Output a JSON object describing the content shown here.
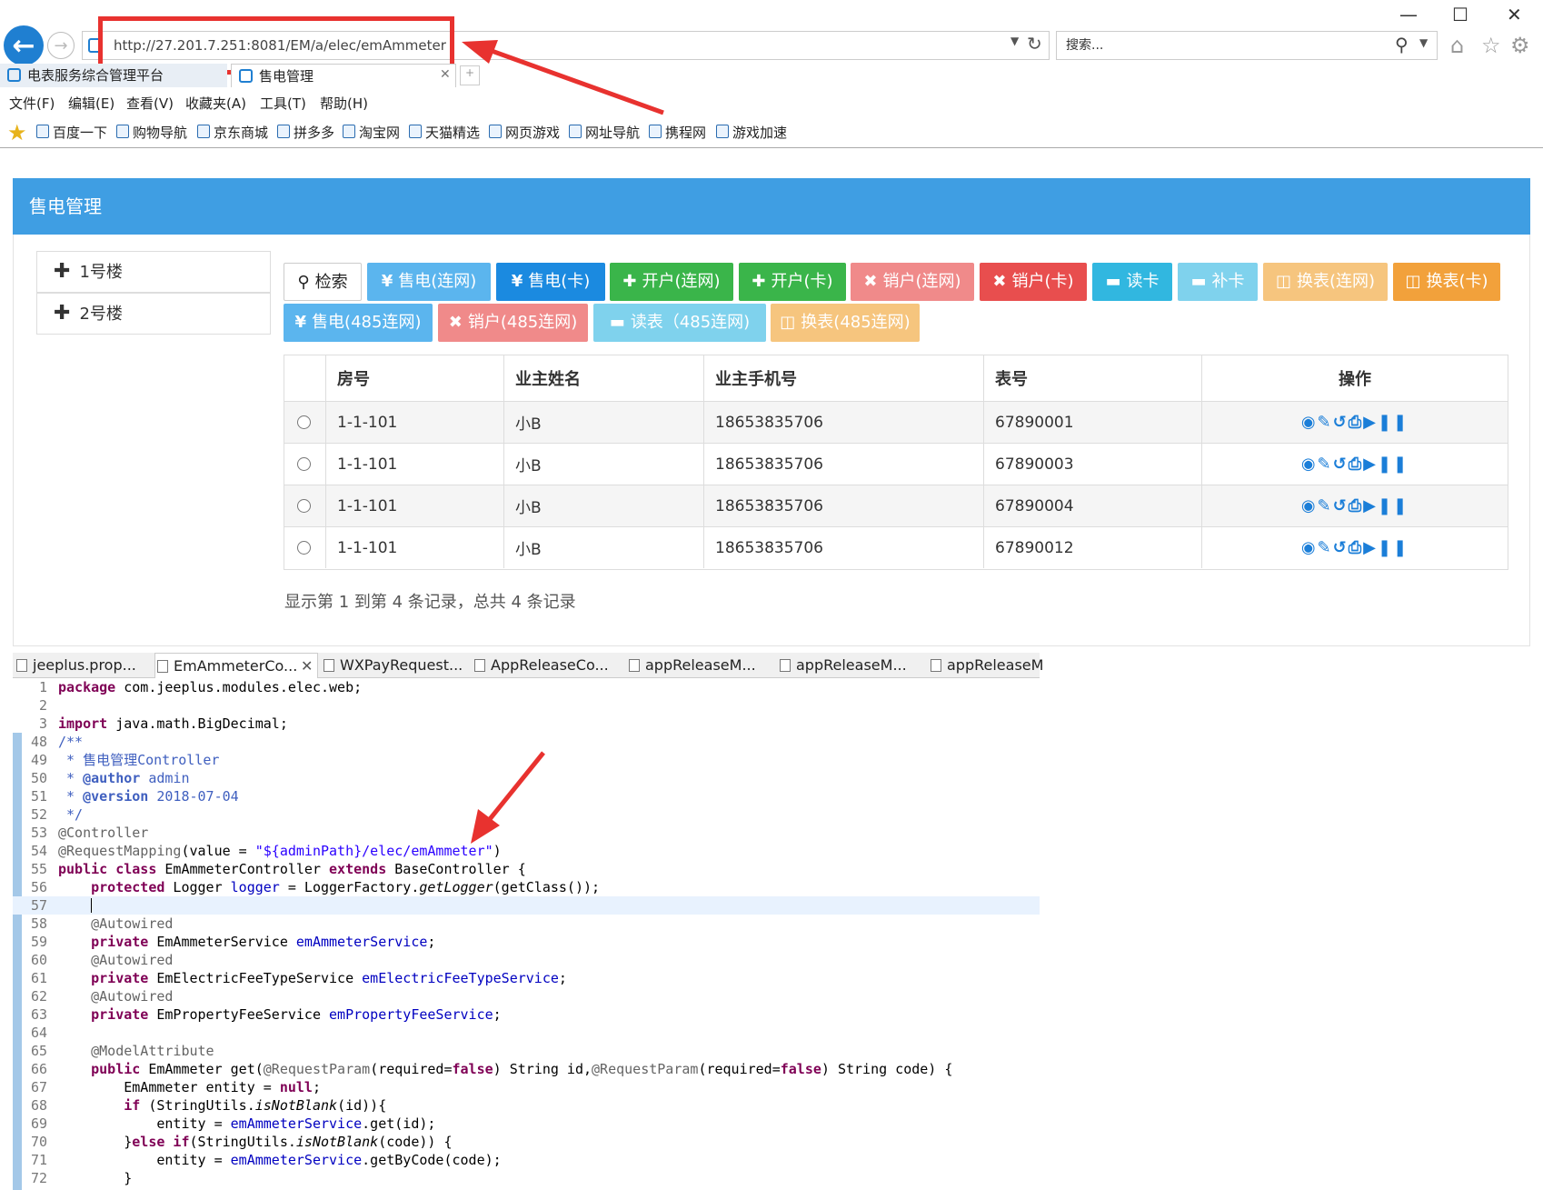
{
  "browser": {
    "url": "http://27.201.7.251:8081/EM/a/elec/emAmmeter",
    "search_placeholder": "搜索...",
    "tabs": [
      {
        "label": "电表服务综合管理平台"
      },
      {
        "label": "售电管理"
      }
    ],
    "menu": [
      "文件(F)",
      "编辑(E)",
      "查看(V)",
      "收藏夹(A)",
      "工具(T)",
      "帮助(H)"
    ],
    "favorites": [
      "百度一下",
      "购物导航",
      "京东商城",
      "拼多多",
      "淘宝网",
      "天猫精选",
      "网页游戏",
      "网址导航",
      "携程网",
      "游戏加速"
    ],
    "accent_color": "#1f7fd1",
    "annotation_color": "#e8322f"
  },
  "page": {
    "panel_title": "售电管理",
    "header_color": "#3f9ee3",
    "tree": [
      {
        "label": "1号楼"
      },
      {
        "label": "2号楼"
      }
    ],
    "buttons_row1": [
      {
        "label": "检索"
      },
      {
        "label": "售电(连网)"
      },
      {
        "label": "售电(卡)"
      },
      {
        "label": "开户(连网)"
      },
      {
        "label": "开户(卡)"
      },
      {
        "label": "销户(连网)"
      },
      {
        "label": "销户(卡)"
      },
      {
        "label": "读卡"
      },
      {
        "label": "补卡"
      },
      {
        "label": "换表(连网)"
      },
      {
        "label": "换表(卡)"
      }
    ],
    "buttons_row2": [
      {
        "label": "售电(485连网)"
      },
      {
        "label": "销户(485连网)"
      },
      {
        "label": "读表（485连网)"
      },
      {
        "label": "换表(485连网)"
      }
    ],
    "table": {
      "columns": [
        "房号",
        "业主姓名",
        "业主手机号",
        "表号",
        "操作"
      ],
      "rows": [
        {
          "room": "1-1-101",
          "owner": "小B",
          "phone": "18653835706",
          "meter": "67890001"
        },
        {
          "room": "1-1-101",
          "owner": "小B",
          "phone": "18653835706",
          "meter": "67890003"
        },
        {
          "room": "1-1-101",
          "owner": "小B",
          "phone": "18653835706",
          "meter": "67890004"
        },
        {
          "room": "1-1-101",
          "owner": "小B",
          "phone": "18653835706",
          "meter": "67890012"
        }
      ],
      "row_action_icons": [
        "eye-icon",
        "edit-icon",
        "refresh-icon",
        "print-icon",
        "play-icon",
        "pause-icon"
      ]
    },
    "summary": "显示第 1 到第 4 条记录，总共 4 条记录"
  },
  "editor": {
    "tabs": [
      {
        "label": "jeeplus.prop..."
      },
      {
        "label": "EmAmmeterCo..."
      },
      {
        "label": "WXPayRequest..."
      },
      {
        "label": "AppReleaseCo..."
      },
      {
        "label": "appReleaseM..."
      },
      {
        "label": "appReleaseM..."
      },
      {
        "label": "appReleaseM"
      }
    ],
    "line_numbers": [
      "1",
      "2",
      "3",
      "48",
      "49",
      "50",
      "51",
      "52",
      "53",
      "54",
      "55",
      "56",
      "57",
      "58",
      "59",
      "60",
      "61",
      "62",
      "63",
      "64",
      "65",
      "66",
      "67",
      "68",
      "69",
      "70",
      "71",
      "72"
    ],
    "code": {
      "l1_kw": "package",
      "l1_rest": " com.jeeplus.modules.elec.web;",
      "l3_kw": "import",
      "l3_rest": " java.math.BigDecimal;",
      "l48": "/**",
      "l49": " * 售电管理Controller",
      "l50a": " * ",
      "l50b": "@author",
      "l50c": " admin",
      "l51a": " * ",
      "l51b": "@version",
      "l51c": " 2018-07-04",
      "l52": " */",
      "l53": "@Controller",
      "l54a": "@RequestMapping",
      "l54b": "(value = ",
      "l54c": "\"${adminPath}/elec/emAmmeter\"",
      "l54d": ")",
      "l55a": "public class",
      "l55b": " EmAmmeterController ",
      "l55c": "extends",
      "l55d": " BaseController {",
      "l56a": "    protected",
      "l56b": " Logger ",
      "l56c": "logger",
      "l56d": " = LoggerFactory.",
      "l56e": "getLogger",
      "l56f": "(getClass());",
      "l57": "    ",
      "l58": "    @Autowired",
      "l59a": "    private",
      "l59b": " EmAmmeterService ",
      "l59c": "emAmmeterService",
      "l59d": ";",
      "l60": "    @Autowired",
      "l61a": "    private",
      "l61b": " EmElectricFeeTypeService ",
      "l61c": "emElectricFeeTypeService",
      "l61d": ";",
      "l62": "    @Autowired",
      "l63a": "    private",
      "l63b": " EmPropertyFeeService ",
      "l63c": "emPropertyFeeService",
      "l63d": ";",
      "l64": "",
      "l65": "    @ModelAttribute",
      "l66a": "    public",
      "l66b": " EmAmmeter get(",
      "l66c": "@RequestParam",
      "l66d": "(required=",
      "l66e": "false",
      "l66f": ") String id,",
      "l66g": "@RequestParam",
      "l66h": "(required=",
      "l66i": "false",
      "l66j": ") String code) {",
      "l67a": "        EmAmmeter entity = ",
      "l67b": "null",
      "l67c": ";",
      "l68a": "        if",
      "l68b": " (StringUtils.",
      "l68c": "isNotBlank",
      "l68d": "(id)){",
      "l69a": "            entity = ",
      "l69b": "emAmmeterService",
      "l69c": ".get(id);",
      "l70a": "        }",
      "l70b": "else if",
      "l70c": "(StringUtils.",
      "l70d": "isNotBlank",
      "l70e": "(code)) {",
      "l71a": "            entity = ",
      "l71b": "emAmmeterService",
      "l71c": ".getByCode(code);",
      "l72": "        }"
    }
  }
}
